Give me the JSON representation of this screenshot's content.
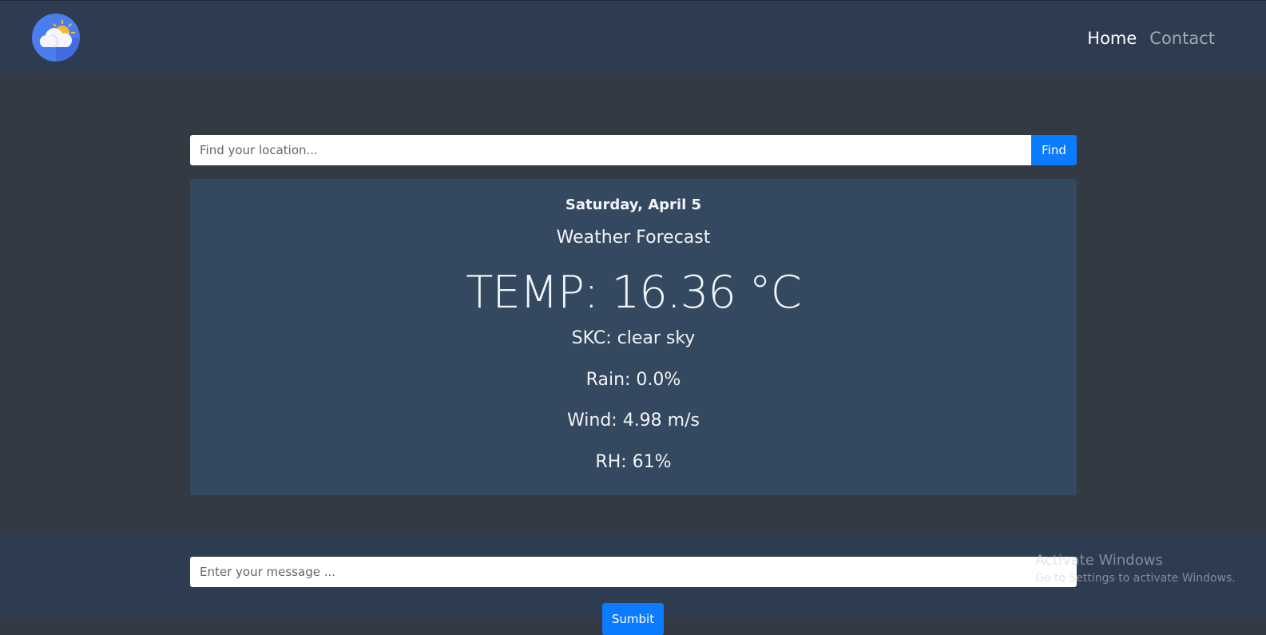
{
  "nav": {
    "logo_icon": "cloud-sun-icon",
    "links": [
      {
        "label": "Home",
        "active": true
      },
      {
        "label": "Contact",
        "active": false
      }
    ]
  },
  "search": {
    "placeholder": "Find your location...",
    "value": "",
    "button_label": "Find"
  },
  "weather": {
    "date": "Saturday, April 5",
    "heading": "Weather Forecast",
    "temp": "TEMP: 16.36 °C",
    "skc": "SKC: clear sky",
    "rain": "Rain: 0.0%",
    "wind": "Wind: 4.98 m/s",
    "rh": "RH: 61%"
  },
  "footer": {
    "message_placeholder": "Enter your message ...",
    "message_value": "",
    "submit_label": "Sumbit"
  },
  "watermark": {
    "title": "Activate Windows",
    "subtitle": "Go to Settings to activate Windows."
  },
  "colors": {
    "page_bg": "#343a44",
    "nav_bg": "#2d3c50",
    "card_bg": "#34495f",
    "accent": "#0b7bff"
  }
}
